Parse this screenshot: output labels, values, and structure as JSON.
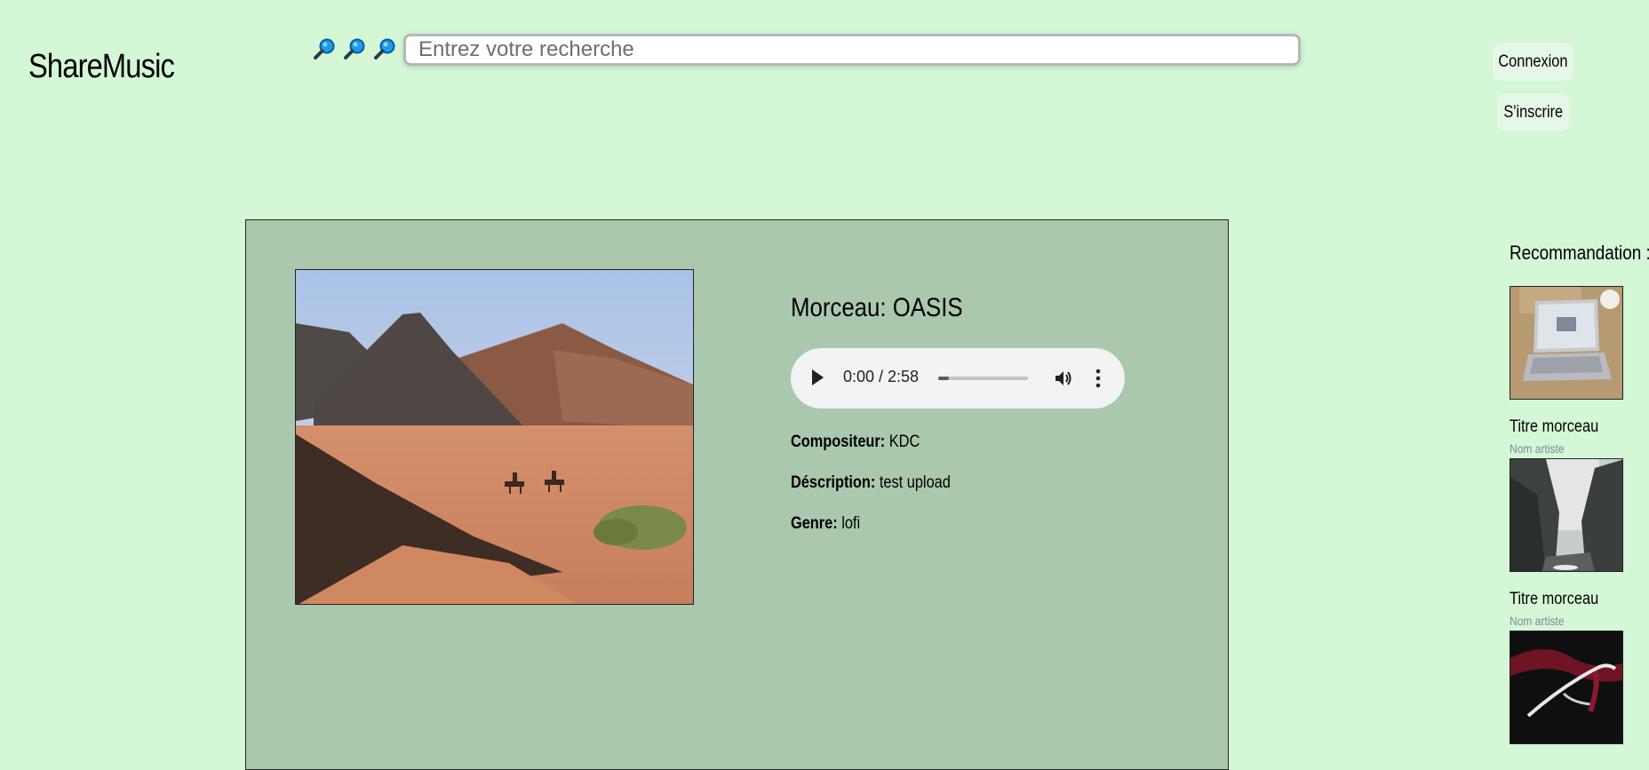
{
  "header": {
    "logo": "ShareMusic",
    "search_icons": [
      "magnifier-icon",
      "magnifier-icon",
      "magnifier-icon"
    ],
    "search_placeholder": "Entrez votre recherche",
    "connexion_label": "Connexion",
    "inscrire_label": "S'inscrire"
  },
  "track": {
    "title": "Morceau: OASIS",
    "cover_icon": "desert-landscape-image",
    "player": {
      "time": "0:00 / 2:58",
      "progress": 0.12
    },
    "compositeur_label": "Compositeur:",
    "compositeur_value": "KDC",
    "description_label": "Déscription:",
    "description_value": "test upload",
    "genre_label": "Genre:",
    "genre_value": "lofi"
  },
  "recommendations": {
    "title": "Recommandation :",
    "items": [
      {
        "image": "laptop-on-desk-image",
        "title": "Titre morceau",
        "artist": "Nom artiste"
      },
      {
        "image": "misty-canyon-image",
        "title": "Titre morceau",
        "artist": "Nom artiste"
      },
      {
        "image": "dark-abstract-image",
        "title": "",
        "artist": ""
      }
    ]
  },
  "colors": {
    "page_background": "#d4f7d6",
    "card_background": "#a9c8ad",
    "button_background": "#e5f7e7",
    "player_background": "#f1f3f4",
    "artist_link": "#7c8a99"
  }
}
